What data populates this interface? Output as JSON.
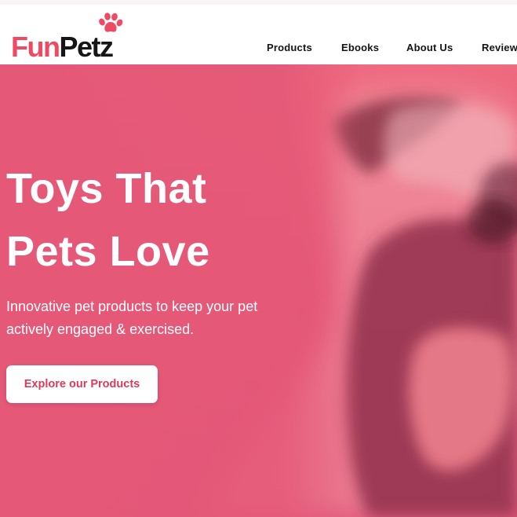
{
  "brand": {
    "part1": "Fun",
    "part2": "Petz",
    "logo_icon": "paw-icon",
    "colors": {
      "accent": "#f04a63",
      "dark": "#161616"
    }
  },
  "nav": {
    "items": [
      {
        "label": "Products"
      },
      {
        "label": "Ebooks"
      },
      {
        "label": "About Us"
      },
      {
        "label": "Reviews"
      }
    ]
  },
  "hero": {
    "title_lines": [
      "Toys That",
      "Pets Love"
    ],
    "subtitle_lines": [
      "Innovative pet products to keep your pet",
      "actively engaged & exercised."
    ],
    "cta_label": "Explore our Products",
    "colors": {
      "overlay": "#e55878",
      "cta_text": "#d93b5d"
    }
  }
}
